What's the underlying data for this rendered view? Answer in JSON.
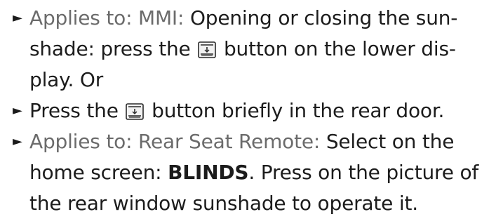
{
  "items": [
    {
      "applies": "Applies to: MMI:",
      "text_before_icon": "Opening or closing the sun-shade: press the",
      "icon": "sunshade-button-icon",
      "text_after_icon": "button on the lower dis-play. Or"
    },
    {
      "text_before_icon": "Press the",
      "icon": "sunshade-button-icon",
      "text_after_icon": "button briefly in the rear door."
    },
    {
      "applies": "Applies to: Rear Seat Remote:",
      "text_before_bold": "Select on the home screen:",
      "bold": "BLINDS",
      "text_after_bold": ". Press on the picture of the rear window sunshade to operate it."
    }
  ],
  "bullet_glyph": "►"
}
